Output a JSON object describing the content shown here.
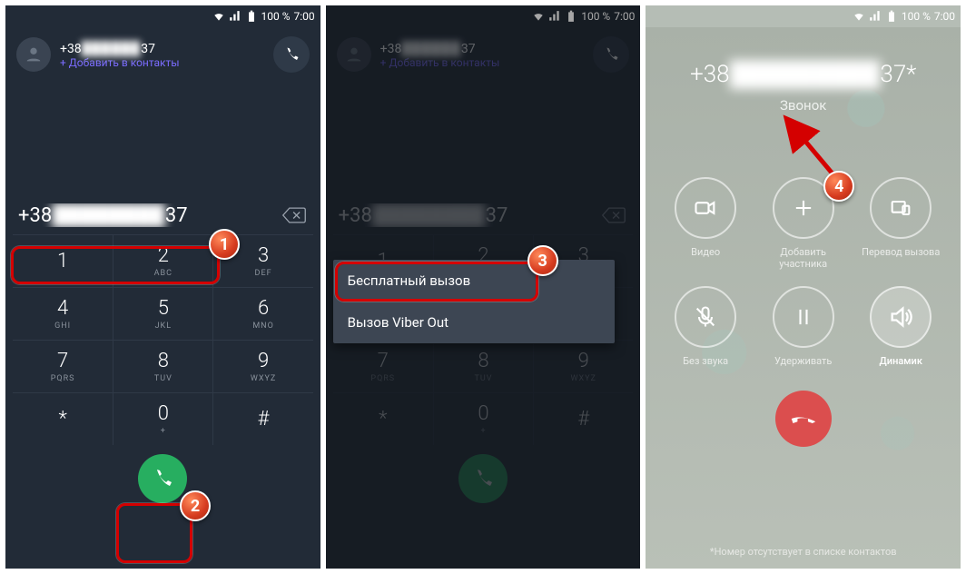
{
  "status": {
    "battery_text": "100 %",
    "time": "7:00"
  },
  "contact": {
    "phone_prefix": "+38",
    "phone_mid_obscured": "██████",
    "phone_suffix": "37",
    "add_label": "+ Добавить в контакты"
  },
  "dialer": {
    "entered_prefix": "+38",
    "entered_obscured": "████████",
    "entered_suffix": "37",
    "keys": [
      {
        "d": "1",
        "l": ""
      },
      {
        "d": "2",
        "l": "ABC"
      },
      {
        "d": "3",
        "l": "DEF"
      },
      {
        "d": "4",
        "l": "GHI"
      },
      {
        "d": "5",
        "l": "JKL"
      },
      {
        "d": "6",
        "l": "MNO"
      },
      {
        "d": "7",
        "l": "PQRS"
      },
      {
        "d": "8",
        "l": "TUV"
      },
      {
        "d": "9",
        "l": "WXYZ"
      },
      {
        "d": "*",
        "l": ""
      },
      {
        "d": "0",
        "l": "+"
      },
      {
        "d": "#",
        "l": ""
      }
    ]
  },
  "menu": {
    "item1": "Бесплатный вызов",
    "item2": "Вызов Viber Out"
  },
  "callscreen": {
    "prefix": "+38",
    "obscured": "█████████",
    "suffix": "37*",
    "status": "Звонок",
    "labels": {
      "video": "Видео",
      "add": "Добавить участника",
      "transfer": "Перевод вызова",
      "mute": "Без звука",
      "hold": "Удерживать",
      "speaker": "Динамик"
    },
    "footnote": "*Номер отсутствует в списке контактов"
  },
  "badges": {
    "b1": "1",
    "b2": "2",
    "b3": "3",
    "b4": "4"
  }
}
